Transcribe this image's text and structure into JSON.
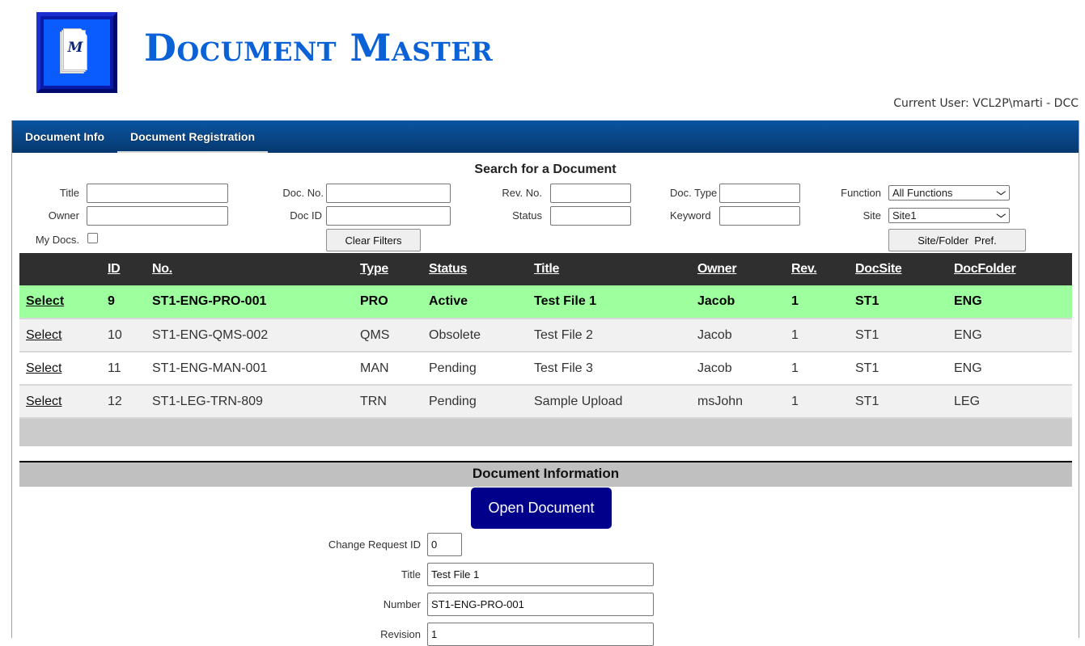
{
  "header": {
    "logo_letter": "M",
    "app_title": "Document Master",
    "current_user": "Current User: VCL2P\\marti - DCC"
  },
  "nav": {
    "tabs": [
      {
        "label": "Document Info",
        "active": true
      },
      {
        "label": "Document Registration",
        "active": false
      }
    ]
  },
  "search": {
    "title": "Search for a Document",
    "fields": {
      "title": {
        "label": "Title",
        "value": ""
      },
      "owner": {
        "label": "Owner",
        "value": ""
      },
      "my_docs": {
        "label": "My Docs.",
        "checked": false
      },
      "doc_no": {
        "label": "Doc. No.",
        "value": ""
      },
      "doc_id": {
        "label": "Doc ID",
        "value": ""
      },
      "rev_no": {
        "label": "Rev. No.",
        "value": ""
      },
      "status": {
        "label": "Status",
        "value": ""
      },
      "doc_type": {
        "label": "Doc. Type",
        "value": ""
      },
      "keyword": {
        "label": "Keyword",
        "value": ""
      },
      "function": {
        "label": "Function",
        "selected": "All Functions"
      },
      "site": {
        "label": "Site",
        "selected": "Site1"
      }
    },
    "clear_filters_label": "Clear Filters",
    "site_folder_pref_label": "Site/Folder  Pref."
  },
  "grid": {
    "columns": [
      "",
      "ID",
      "No.",
      "Type",
      "Status",
      "Title",
      "Owner",
      "Rev.",
      "DocSite",
      "DocFolder"
    ],
    "select_label": "Select",
    "rows": [
      {
        "id": "9",
        "no": "ST1-ENG-PRO-001",
        "type": "PRO",
        "status": "Active",
        "title": "Test File 1",
        "owner": "Jacob",
        "rev": "1",
        "site": "ST1",
        "folder": "ENG",
        "selected": true
      },
      {
        "id": "10",
        "no": "ST1-ENG-QMS-002",
        "type": "QMS",
        "status": "Obsolete",
        "title": "Test File 2",
        "owner": "Jacob",
        "rev": "1",
        "site": "ST1",
        "folder": "ENG",
        "selected": false
      },
      {
        "id": "11",
        "no": "ST1-ENG-MAN-001",
        "type": "MAN",
        "status": "Pending",
        "title": "Test File 3",
        "owner": "Jacob",
        "rev": "1",
        "site": "ST1",
        "folder": "ENG",
        "selected": false
      },
      {
        "id": "12",
        "no": "ST1-LEG-TRN-809",
        "type": "TRN",
        "status": "Pending",
        "title": "Sample Upload",
        "owner": "msJohn",
        "rev": "1",
        "site": "ST1",
        "folder": "LEG",
        "selected": false
      }
    ]
  },
  "doc_info": {
    "header": "Document Information",
    "open_button": "Open Document",
    "fields": {
      "change_request_id": {
        "label": "Change Request ID",
        "value": "0"
      },
      "title": {
        "label": "Title",
        "value": "Test File 1"
      },
      "number": {
        "label": "Number",
        "value": "ST1-ENG-PRO-001"
      },
      "revision": {
        "label": "Revision",
        "value": "1"
      }
    }
  },
  "colors": {
    "brand_blue": "#0b62d6",
    "nav_blue": "#0a54a0",
    "selected_row": "#9eff9e",
    "open_button": "#00008b",
    "grid_header": "#2f2f2f"
  }
}
